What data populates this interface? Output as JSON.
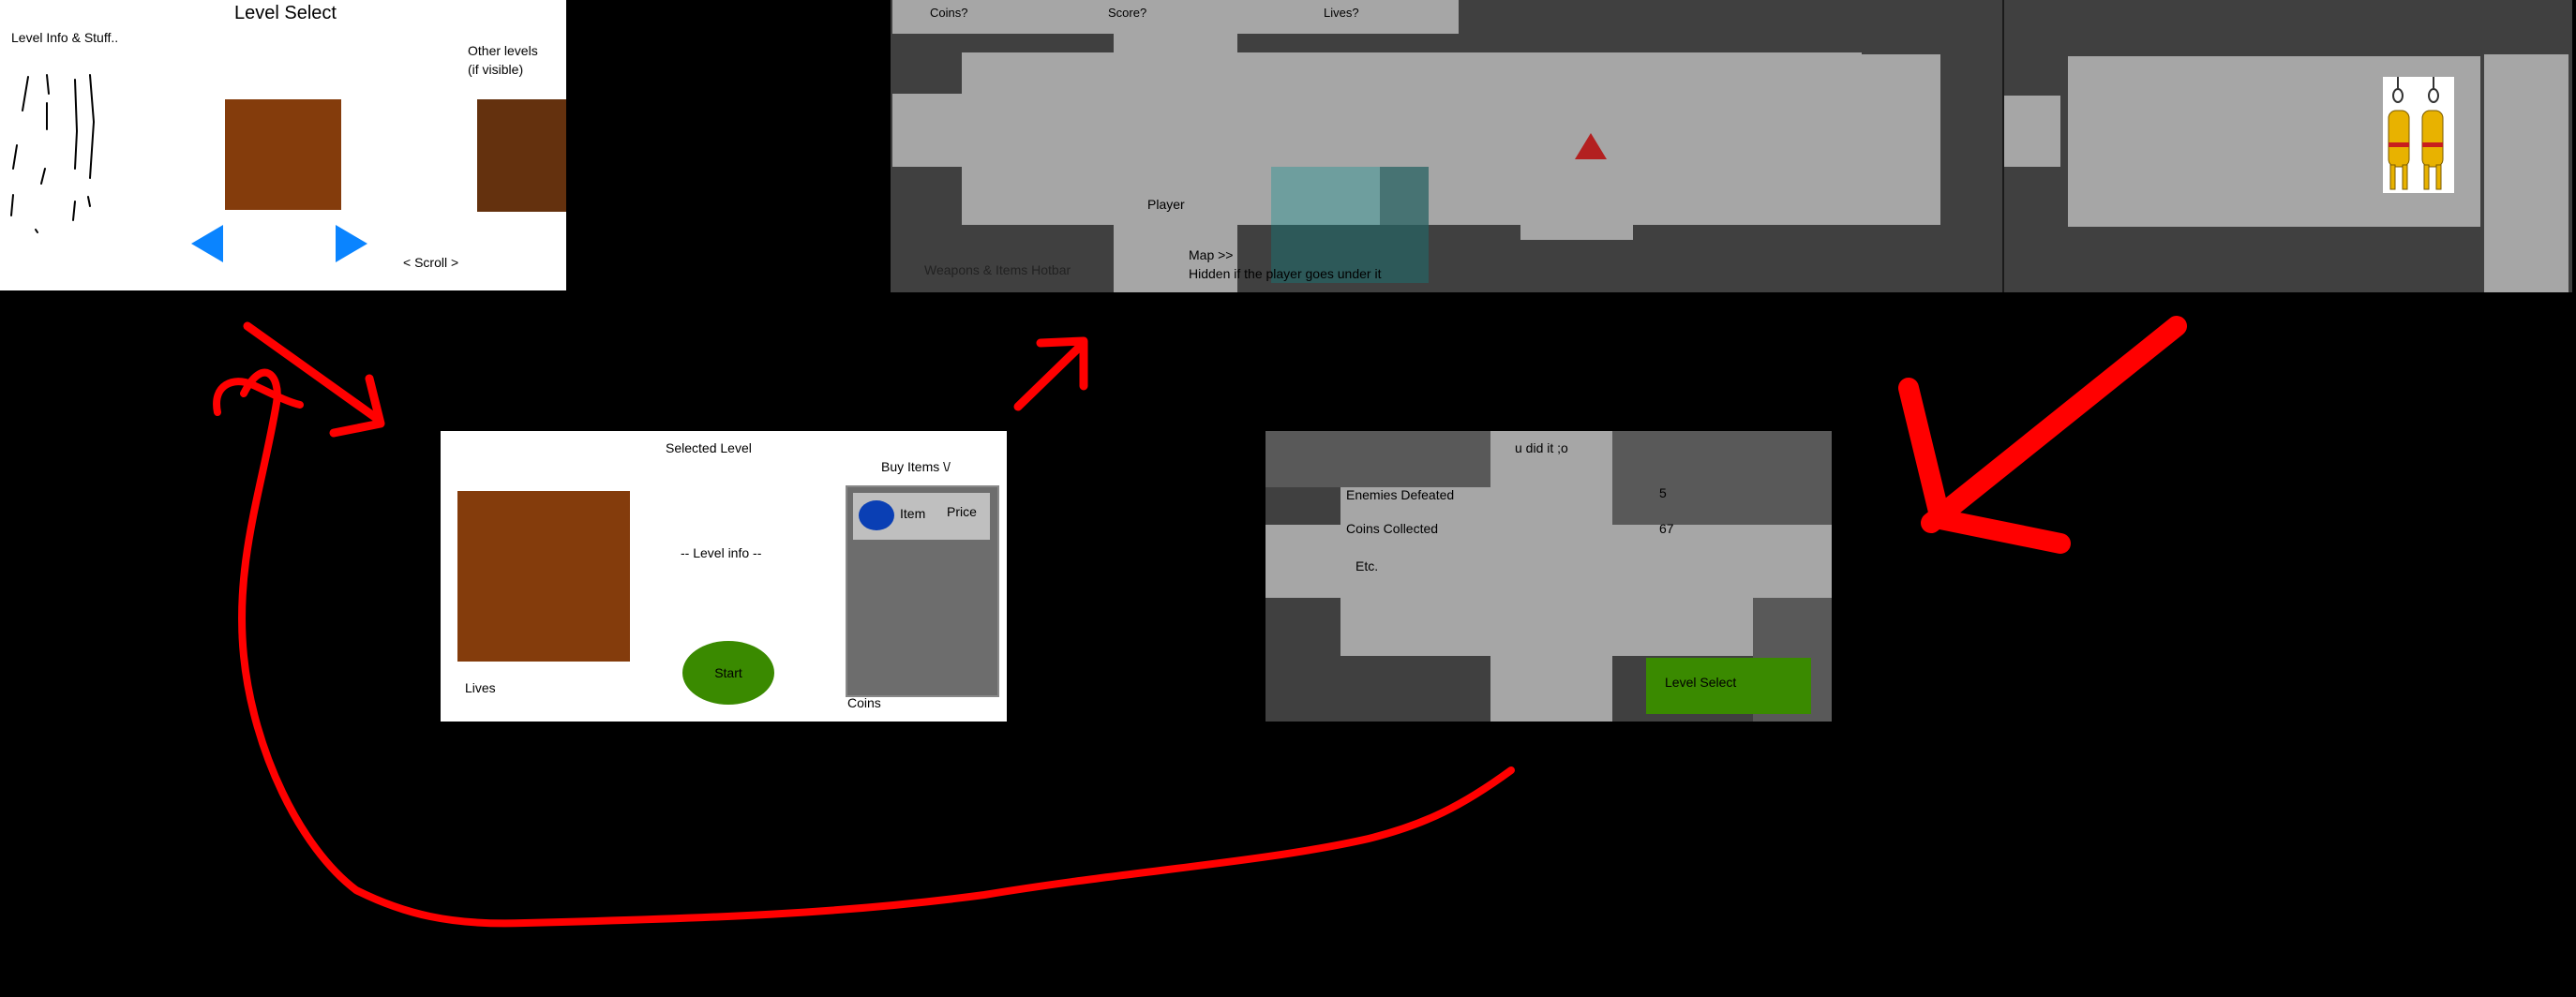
{
  "level_select": {
    "title": "Level Select",
    "info_label": "Level Info & Stuff..",
    "other_levels_line1": "Other levels",
    "other_levels_line2": "(if visible)",
    "scroll_label": "< Scroll >",
    "level_color": "#843c0c",
    "other_level_color": "#64310e",
    "arrow_color": "#0a84ff"
  },
  "level_detail": {
    "title": "Selected Level",
    "level_info": "-- Level info --",
    "lives_label": "Lives",
    "start_label": "Start",
    "buy_label": "Buy Items \\/",
    "item_label": "Item",
    "price_label": "Price",
    "coins_label": "Coins",
    "start_color": "#3a8a00",
    "item_icon_color": "#0a3fb4"
  },
  "gameplay": {
    "hud": {
      "coins": "Coins?",
      "score": "Score?",
      "lives": "Lives?"
    },
    "player_label": "Player",
    "hotbar_label": "Weapons & Items Hotbar",
    "map_line1": "Map >>",
    "map_line2": "Hidden if the player goes under it",
    "enemy_color": "#b32020"
  },
  "results": {
    "title": "u did it ;o",
    "rows": [
      {
        "label": "Enemies Defeated",
        "value": "5"
      },
      {
        "label": "Coins Collected",
        "value": "67"
      },
      {
        "label": "Etc.",
        "value": ""
      }
    ],
    "level_select_button": "Level Select",
    "button_color": "#3a8a00"
  },
  "flow_color": "#ff0000"
}
